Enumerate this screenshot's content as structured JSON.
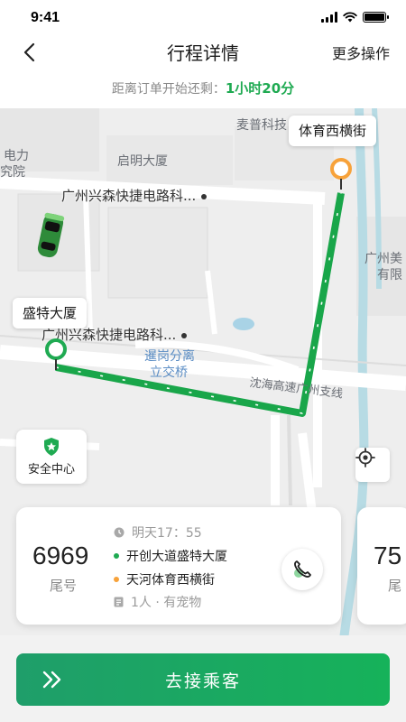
{
  "status_bar": {
    "time": "9:41"
  },
  "nav": {
    "title": "行程详情",
    "more_label": "更多操作"
  },
  "countdown": {
    "prefix": "距离订单开始还剩：",
    "value": "1小时20分"
  },
  "map": {
    "labels": {
      "maipu": "麦普科技",
      "qiming": "启明大厦",
      "dianli": "电力",
      "jiusuo": "究院",
      "guangzhou_mei": "广州美",
      "youxian": "有限",
      "interchange_1": "暹岗分离",
      "interchange_2": "立交桥",
      "expressway": "沈海高速广州支线"
    },
    "poi_1": "广州兴森快捷电路科...",
    "poi_2": "广州兴森快捷电路科...",
    "origin_bubble": "盛特大厦",
    "destination_bubble": "体育西横街",
    "route_color": "#19a64a",
    "origin_color": "#1faa52",
    "destination_color": "#f7a23a"
  },
  "safety": {
    "label": "安全中心"
  },
  "order_card": {
    "tail_number": "6969",
    "tail_label": "尾号",
    "time": "明天17：55",
    "origin": "开创大道盛特大厦",
    "destination": "天河体育西横街",
    "passengers": "1人 · 有宠物"
  },
  "order_card_peek": {
    "tail_number": "75",
    "tail_label": "尾"
  },
  "slider": {
    "label": "去接乘客"
  }
}
